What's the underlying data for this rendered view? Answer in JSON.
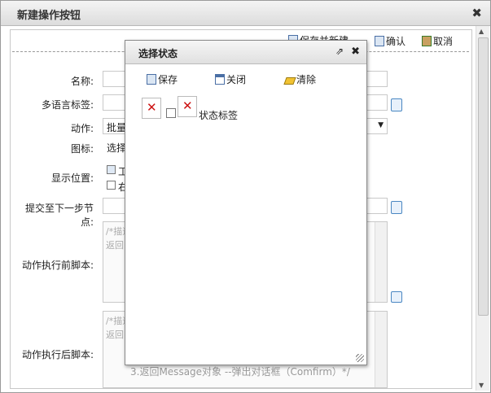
{
  "window": {
    "title": "新建操作按钮",
    "close_glyph": "✖"
  },
  "toolbar": {
    "save_new": "保存并新建",
    "confirm": "确认",
    "cancel": "取消"
  },
  "form": {
    "name_label": "名称:",
    "i18n_label": "多语言标签:",
    "action_label": "动作:",
    "action_value": "批量",
    "icon_label": "图标:",
    "icon_value": "选择",
    "display_label": "显示位置:",
    "display_opt1": "工",
    "display_opt2": "右",
    "submit_label": "提交至下一步节点:",
    "pre_script_label": "动作执行前脚本:",
    "pre_script_hint1": "/*描述",
    "pre_script_hint2": "返回",
    "post_script_label": "动作执行后脚本:",
    "post_script_hint1": "/*描述",
    "post_script_hint2": "返回",
    "post_script_hint3": "3.返回Message对象 --弹出对话框（Comfirm）*/"
  },
  "dialog": {
    "title": "选择状态",
    "save": "保存",
    "close": "关闭",
    "clear": "清除",
    "status_label": "状态标签",
    "popout_glyph": "⇗",
    "close_glyph": "✖"
  },
  "icons": [
    "close-icon",
    "save-icon",
    "confirm-icon",
    "cancel-icon",
    "edit-icon",
    "broken-image-icon",
    "popout-icon",
    "clear-icon",
    "resize-grip-icon"
  ]
}
